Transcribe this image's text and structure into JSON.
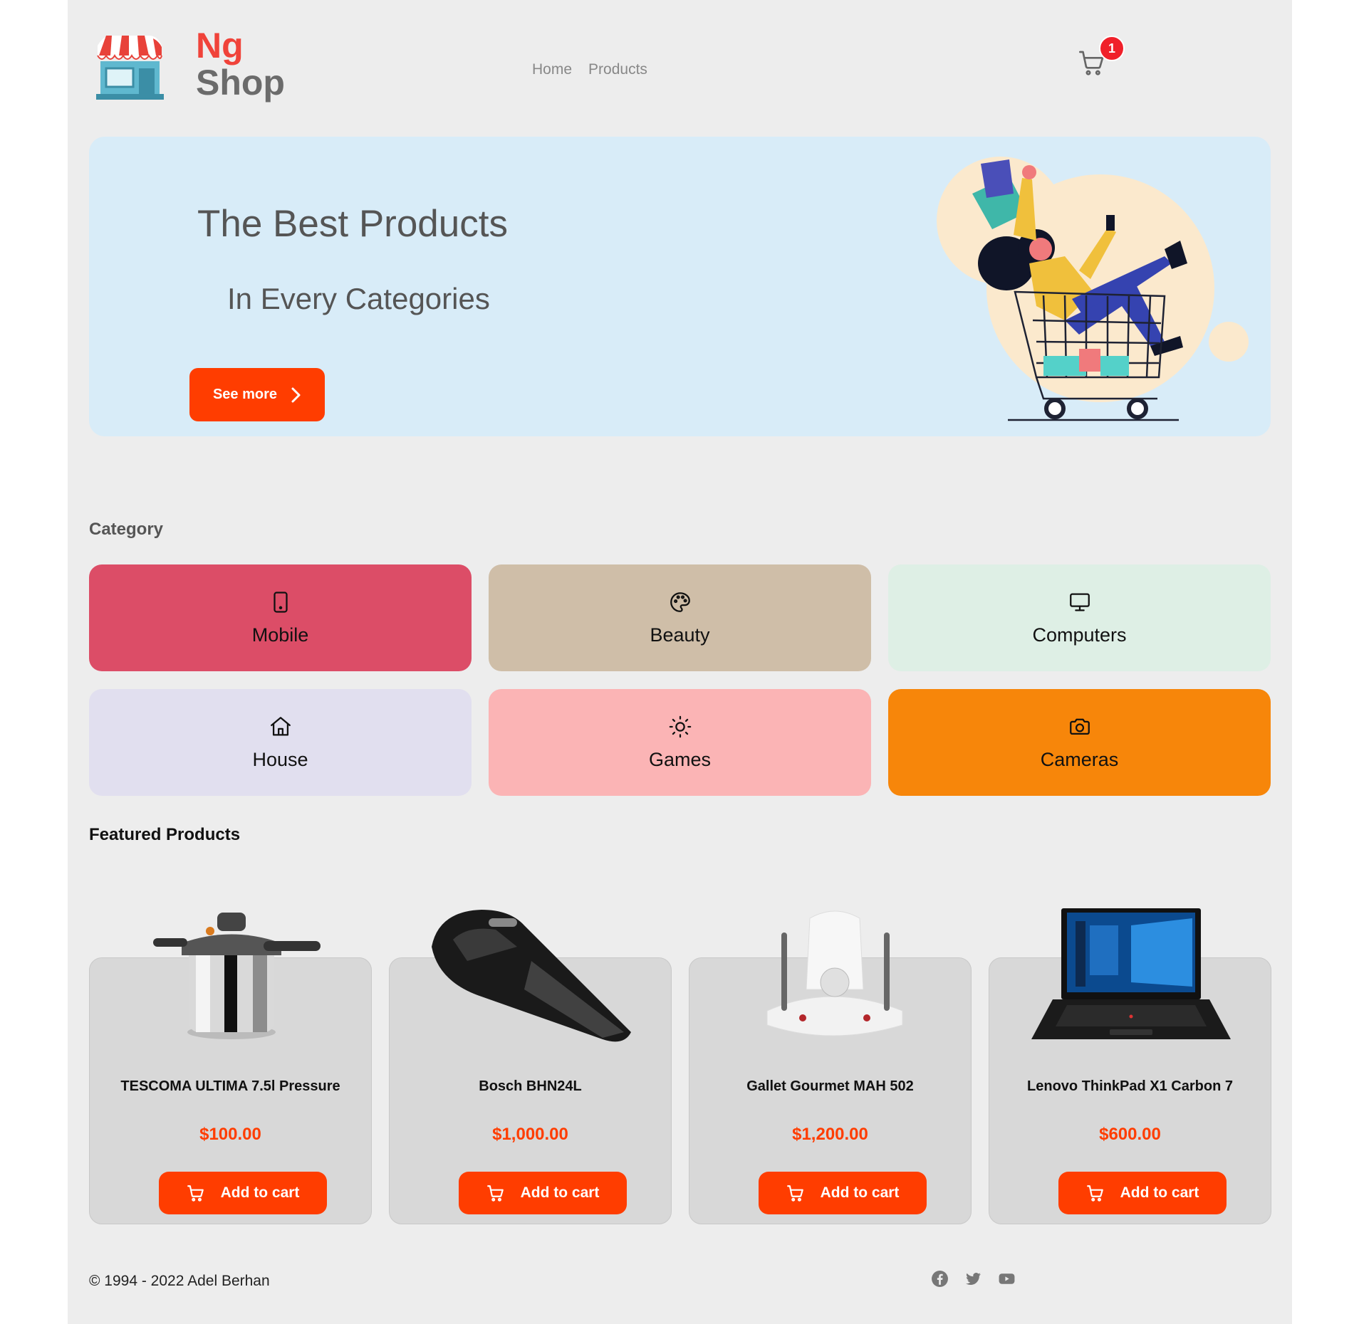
{
  "logo": {
    "line1": "Ng",
    "line2": "Shop"
  },
  "nav": {
    "items": [
      "Home",
      "Products"
    ]
  },
  "cart": {
    "count": "1"
  },
  "hero": {
    "title": "The Best Products",
    "subtitle": "In Every Categories",
    "button_label": "See more"
  },
  "categories": {
    "heading": "Category",
    "items": [
      {
        "label": "Mobile",
        "icon": "mobile-icon",
        "color": "#dc4d67"
      },
      {
        "label": "Beauty",
        "icon": "palette-icon",
        "color": "#cfbea8"
      },
      {
        "label": "Computers",
        "icon": "monitor-icon",
        "color": "#deefe5"
      },
      {
        "label": "House",
        "icon": "house-icon",
        "color": "#e1dfef"
      },
      {
        "label": "Games",
        "icon": "sun-icon",
        "color": "#fbb4b5"
      },
      {
        "label": "Cameras",
        "icon": "camera-icon",
        "color": "#f7860a"
      }
    ]
  },
  "featured": {
    "heading": "Featured Products",
    "button_label": "Add to cart",
    "products": [
      {
        "name": "TESCOMA ULTIMA 7.5l Pressure",
        "price": "$100.00",
        "image": "pressure-cooker"
      },
      {
        "name": "Bosch BHN24L",
        "price": "$1,000.00",
        "image": "handheld-vacuum"
      },
      {
        "name": "Gallet Gourmet MAH 502",
        "price": "$1,200.00",
        "image": "food-processor"
      },
      {
        "name": "Lenovo ThinkPad X1 Carbon 7",
        "price": "$600.00",
        "image": "laptop"
      }
    ]
  },
  "footer": {
    "copyright": "© 1994 - 2022 Adel Berhan",
    "socials": [
      "facebook-icon",
      "twitter-icon",
      "youtube-icon"
    ]
  },
  "colors": {
    "accent": "#ff3d00",
    "hero_bg": "#d8ecf8",
    "page_bg": "#ededed"
  }
}
